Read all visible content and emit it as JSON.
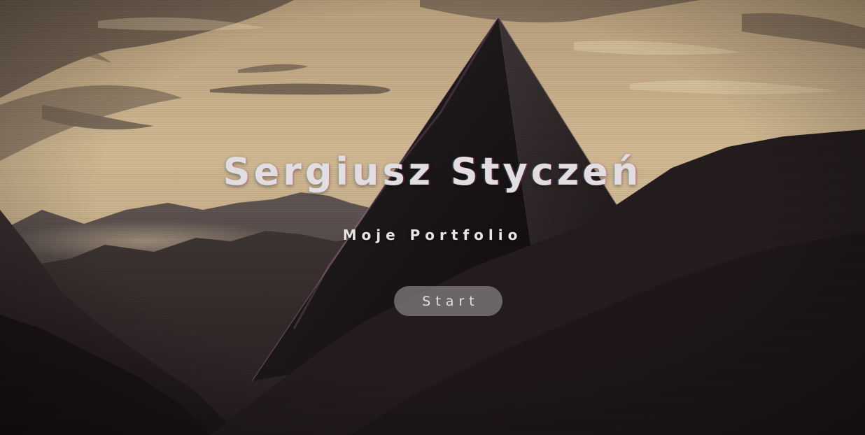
{
  "hero": {
    "title": "Sergiusz Styczeń",
    "subtitle": "Moje Portfolio",
    "start_label": "Start"
  },
  "colors": {
    "sky": "#cdb58f",
    "mountain_dark": "#1e1718",
    "pyramid": "#120e0f",
    "text": "#e2dde0",
    "button_bg": "#969496"
  }
}
